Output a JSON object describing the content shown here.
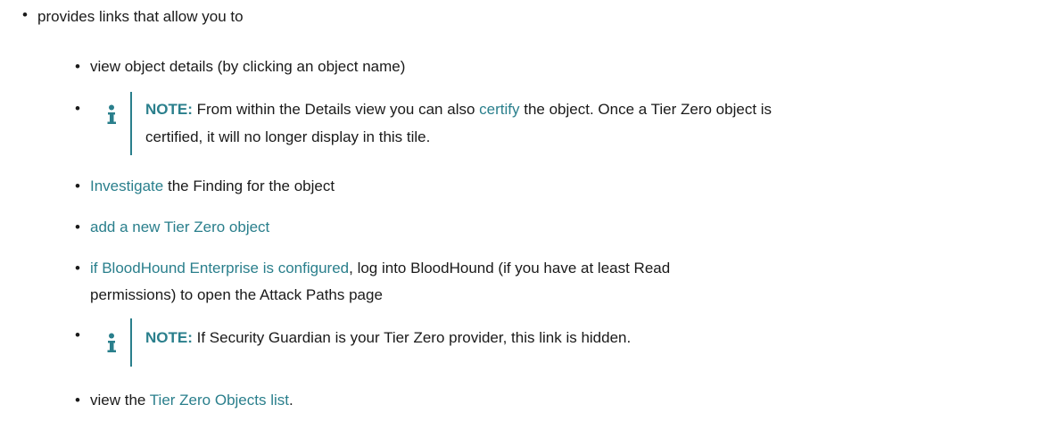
{
  "top_item": {
    "text": "provides links that allow you to"
  },
  "items": {
    "view_details": {
      "text": "view object details (by clicking an object name)"
    },
    "note1": {
      "label": "NOTE:",
      "text_before": "From within the Details view you can also",
      "link": "certify",
      "text_after": "the object. Once a Tier Zero object is",
      "line2": "certified, it will no longer display in this tile."
    },
    "investigate": {
      "link": "Investigate",
      "text": "the Finding for the object"
    },
    "add_object": {
      "link": "add a new Tier Zero object"
    },
    "bloodhound": {
      "link": "if BloodHound Enterprise is configured",
      "text": ", log into BloodHound (if you have at least Read",
      "line2": "permissions) to open the Attack Paths page"
    },
    "note2": {
      "label": "NOTE:",
      "text": "If Security Guardian is your Tier Zero provider, this link is hidden."
    },
    "objects_list": {
      "text_before": "view the",
      "link": "Tier Zero Objects list",
      "text_after": "."
    }
  },
  "colors": {
    "link": "#2a7f8c",
    "note_icon": "#2a7f8c",
    "text": "#1a1a1a"
  },
  "icons": {
    "note": "info-icon",
    "bullet": "bullet-dot"
  }
}
